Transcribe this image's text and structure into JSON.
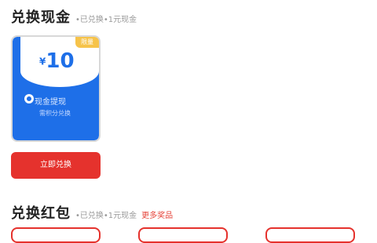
{
  "section1": {
    "title": "兑换现金",
    "subtitle": "•已兑换•1元现金"
  },
  "voucher": {
    "amount": "10",
    "currency": "¥",
    "tag": "限量",
    "label1": "现金提现",
    "label2": "需积分兑换"
  },
  "actions": {
    "exchange_button": "立即兑换"
  },
  "section2": {
    "title": "兑换红包",
    "subtitle": "•已兑换•1元现金",
    "link": "更多奖品"
  },
  "colors": {
    "accent_red": "#e5322d",
    "accent_blue": "#1e6fe8",
    "tag_yellow": "#f6c34a"
  },
  "icons": {
    "voucher_logo": "wallet-icon"
  }
}
